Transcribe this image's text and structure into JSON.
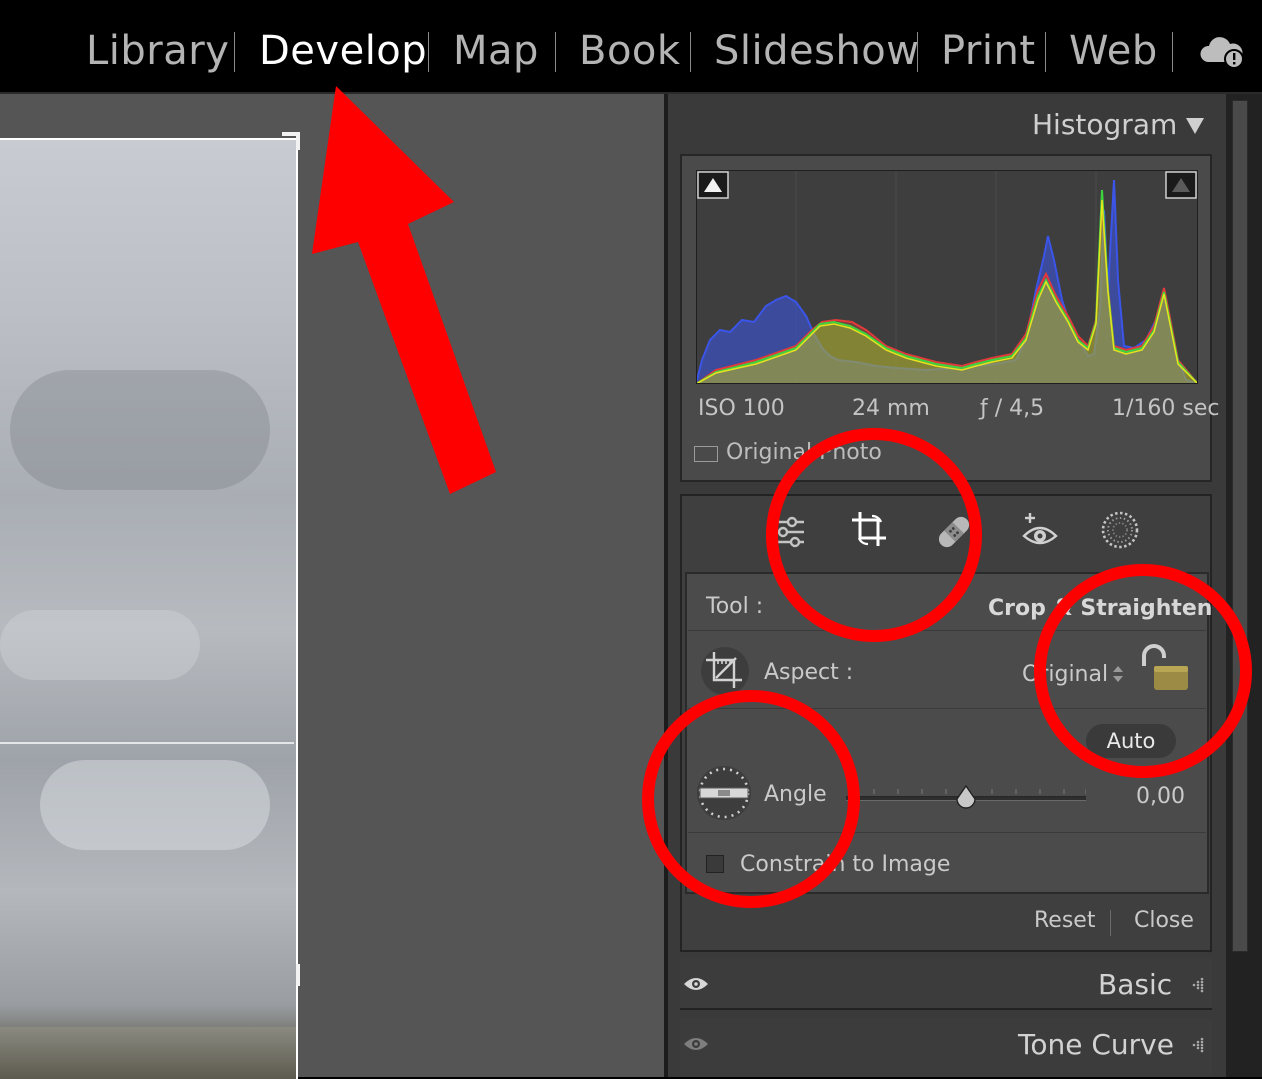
{
  "modules": {
    "items": [
      {
        "label": "Library",
        "active": false
      },
      {
        "label": "Develop",
        "active": true
      },
      {
        "label": "Map",
        "active": false
      },
      {
        "label": "Book",
        "active": false
      },
      {
        "label": "Slideshow",
        "active": false
      },
      {
        "label": "Print",
        "active": false
      },
      {
        "label": "Web",
        "active": false
      }
    ],
    "cloud_icon": "cloud-sync-warning-icon"
  },
  "histogram": {
    "title": "Histogram",
    "iso": "ISO 100",
    "focal": "24 mm",
    "aperture": "ƒ / 4,5",
    "shutter": "1/160 sec",
    "original_photo_label": "Original Photo",
    "channel_colors": {
      "red": "#e23a3a",
      "green": "#3fd23f",
      "blue": "#3b55e8",
      "luminance": "#e6e21f"
    }
  },
  "tool_strip": {
    "icons": [
      "edit-sliders-icon",
      "crop-icon",
      "healing-bandage-icon",
      "red-eye-icon",
      "masking-icon"
    ]
  },
  "crop_panel": {
    "tool_label": "Tool :",
    "tool_value": "Crop & Straighten",
    "aspect_label": "Aspect :",
    "aspect_value": "Original",
    "auto_label": "Auto",
    "angle_label": "Angle",
    "angle_value": "0,00",
    "angle_position": 0.5,
    "constrain_label": "Constrain to Image",
    "constrain_checked": false,
    "reset_label": "Reset",
    "close_label": "Close"
  },
  "sections": {
    "basic": "Basic",
    "tone_curve": "Tone Curve"
  },
  "annotation_color": "#ff0000"
}
